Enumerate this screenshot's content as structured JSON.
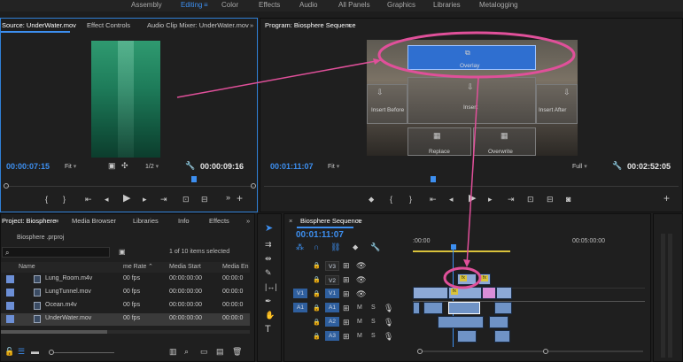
{
  "workspaces": {
    "items": [
      "Assembly",
      "Editing",
      "Color",
      "Effects",
      "Audio",
      "All Panels",
      "Graphics",
      "Libraries",
      "Metalogging"
    ],
    "active": "Editing"
  },
  "source_panel": {
    "tabs": [
      "Source: UnderWater.mov",
      "Effect Controls",
      "Audio Clip Mixer: UnderWater.mov"
    ],
    "menu_glyph": "≡",
    "more_glyph": "»",
    "timecode_in": "00:00:07:15",
    "fit": "Fit",
    "resolution": "1/2",
    "timecode_out": "00:00:09:16"
  },
  "program_panel": {
    "title": "Program: Biosphere Sequence",
    "menu_glyph": "≡",
    "timecode_in": "00:01:11:07",
    "fit": "Fit",
    "quality": "Full",
    "timecode_out": "00:02:52:05",
    "drop_zones": {
      "overlay": "Overlay",
      "insert_before": "Insert Before",
      "insert": "Insert",
      "insert_after": "Insert After",
      "replace": "Replace",
      "overwrite": "Overwrite"
    }
  },
  "project_panel": {
    "tabs": [
      "Project: Biosphere",
      "Media Browser",
      "Libraries",
      "Info",
      "Effects"
    ],
    "project_file": "Biosphere .prproj",
    "search_placeholder": "",
    "items_selected": "1 of 10 items selected",
    "columns": [
      "Name",
      "me Rate",
      "Media Start",
      "Media En"
    ],
    "rows": [
      {
        "name": "Lung_Room.m4v",
        "rate": "00 fps",
        "start": "00:00:00:00",
        "end": "00:00:0"
      },
      {
        "name": "LungTunnel.mov",
        "rate": "00 fps",
        "start": "00:00:00:00",
        "end": "00:00:0"
      },
      {
        "name": "Ocean.m4v",
        "rate": "00 fps",
        "start": "00:00:00:00",
        "end": "00:00:0"
      },
      {
        "name": "UnderWater.mov",
        "rate": "00 fps",
        "start": "00:00:00:00",
        "end": "00:00:0"
      }
    ]
  },
  "timeline_panel": {
    "title": "Biosphere Sequence",
    "menu_glyph": "≡",
    "timecode": "00:01:11:07",
    "ruler_start": ":00:00",
    "ruler_mid": "00:05:00:00",
    "tracks": [
      {
        "src": "",
        "name": "V3",
        "lock": "🔒"
      },
      {
        "src": "",
        "name": "V2",
        "lock": "🔒"
      },
      {
        "src": "V1",
        "name": "V1",
        "lock": "🔒"
      },
      {
        "src": "A1",
        "name": "A1",
        "lock": "🔒"
      },
      {
        "src": "",
        "name": "A2",
        "lock": "🔒"
      },
      {
        "src": "",
        "name": "A3",
        "lock": "🔒"
      }
    ],
    "mute": "M",
    "solo": "S",
    "fx": "fx"
  },
  "colors": {
    "accent": "#3d8ff0",
    "annotation": "#e0509a",
    "overlay_blue": "#2f6fd0"
  }
}
